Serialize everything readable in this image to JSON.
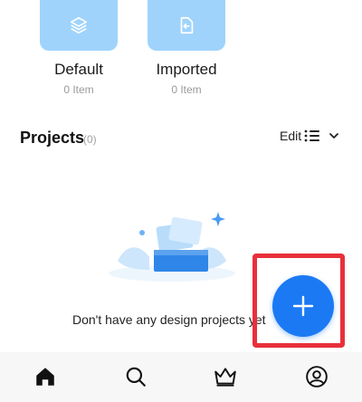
{
  "folders": [
    {
      "name": "Default",
      "count": "0 Item",
      "icon": "layers-icon"
    },
    {
      "name": "Imported",
      "count": "0 Item",
      "icon": "import-file-icon"
    }
  ],
  "projects": {
    "title": "Projects",
    "count": "(0)",
    "edit_label": "Edit",
    "empty_text": "Don't have any design projects yet"
  },
  "fab": {
    "icon": "plus-icon"
  },
  "bottom_nav": [
    {
      "icon": "home-icon",
      "active": true
    },
    {
      "icon": "search-icon"
    },
    {
      "icon": "crown-icon"
    },
    {
      "icon": "profile-icon"
    }
  ],
  "colors": {
    "accent": "#1b7af3",
    "tile": "#9fd3fb",
    "highlight": "#e8303a"
  }
}
